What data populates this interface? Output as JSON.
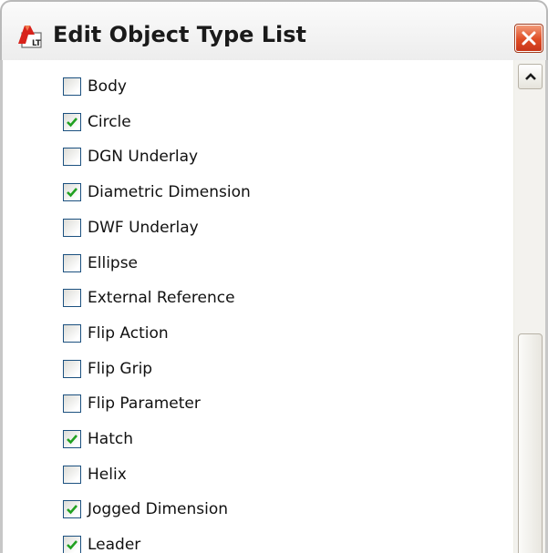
{
  "window": {
    "title": "Edit Object Type List",
    "app_icon": "autocad-lt-icon",
    "app_icon_text": "LT",
    "close_icon": "close-icon"
  },
  "colors": {
    "check": "#21a121",
    "checkbox_border": "#1c5180",
    "close_button": "#df4d25"
  },
  "list": {
    "items": [
      {
        "label": "Body",
        "checked": false
      },
      {
        "label": "Circle",
        "checked": true
      },
      {
        "label": "DGN Underlay",
        "checked": false
      },
      {
        "label": "Diametric Dimension",
        "checked": true
      },
      {
        "label": "DWF Underlay",
        "checked": false
      },
      {
        "label": "Ellipse",
        "checked": false
      },
      {
        "label": "External Reference",
        "checked": false
      },
      {
        "label": "Flip Action",
        "checked": false
      },
      {
        "label": "Flip Grip",
        "checked": false
      },
      {
        "label": "Flip Parameter",
        "checked": false
      },
      {
        "label": "Hatch",
        "checked": true
      },
      {
        "label": "Helix",
        "checked": false
      },
      {
        "label": "Jogged Dimension",
        "checked": true
      },
      {
        "label": "Leader",
        "checked": true
      }
    ]
  },
  "scrollbar": {
    "up_icon": "chevron-up-icon"
  }
}
